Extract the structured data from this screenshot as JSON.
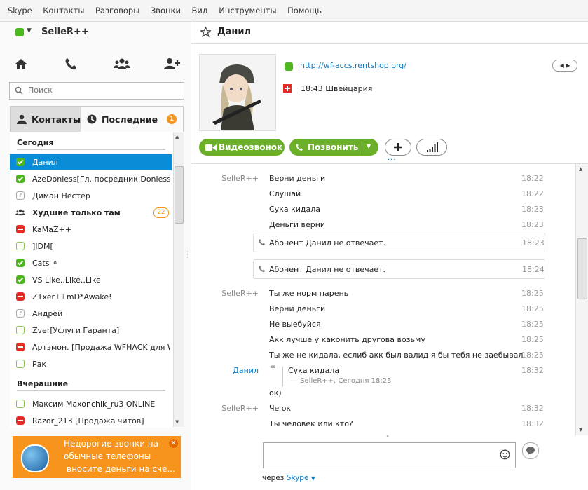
{
  "menu": [
    "Skype",
    "Контакты",
    "Разговоры",
    "Звонки",
    "Вид",
    "Инструменты",
    "Помощь"
  ],
  "user": {
    "name": "SelleR++"
  },
  "search": {
    "placeholder": "Поиск"
  },
  "tabs": {
    "contacts": "Контакты",
    "recent": "Последние",
    "recent_badge": "1"
  },
  "sections": {
    "today": "Сегодня",
    "yesterday": "Вчерашние"
  },
  "contacts_today": [
    {
      "name": "Данил",
      "status": "online",
      "selected": true
    },
    {
      "name": "AzeDonless[Гл. посредник DonlessHa...",
      "status": "online"
    },
    {
      "name": "Диман Нестер",
      "status": "unknown"
    },
    {
      "name": "Худшие только там",
      "status": "group",
      "badge": "22",
      "bold": true
    },
    {
      "name": "KaMaZ++",
      "status": "busy"
    },
    {
      "name": "]JDM[",
      "status": "offline"
    },
    {
      "name": "Cats ⚬",
      "status": "online"
    },
    {
      "name": "VS Like..Like..Like",
      "status": "online"
    },
    {
      "name": "Z1xer ☐ mD*Awake!",
      "status": "busy"
    },
    {
      "name": "Андрей",
      "status": "unknown"
    },
    {
      "name": "Zver[Услуги Гаранта]",
      "status": "offline"
    },
    {
      "name": "Артэмон. [Продажа WFHACK для WF]",
      "status": "busy"
    },
    {
      "name": "Рак",
      "status": "offline"
    }
  ],
  "contacts_yesterday": [
    {
      "name": "Максим Maxonchik_ru3 ONLINE",
      "status": "offline"
    },
    {
      "name": "Razor_213 [Продажа читов]",
      "status": "busy"
    }
  ],
  "ad": {
    "line1": "Недорогие звонки на",
    "line2": "обычные телефоны",
    "line3": "вносите деньги на сче..."
  },
  "chat": {
    "title": "Данил",
    "website": "http://wf-accs.rentshop.org/",
    "local_time": "18:43 Швейцария",
    "video_btn": "Видеозвонок",
    "call_btn": "Позвонить"
  },
  "messages": [
    {
      "sender": "SelleR++",
      "text": "Верни деньги",
      "time": "18:22"
    },
    {
      "sender": "",
      "text": "Слушай",
      "time": "18:22"
    },
    {
      "sender": "",
      "text": "Сука кидала",
      "time": "18:23"
    },
    {
      "sender": "",
      "text": "Деньги верни",
      "time": "18:23"
    },
    {
      "call": true,
      "text": "Абонент Данил не отвечает.",
      "time": "18:23"
    },
    {
      "call": true,
      "text": "Абонент Данил не отвечает.",
      "time": "18:24"
    },
    {
      "sender": "SelleR++",
      "text": "Ты же норм парень",
      "time": "18:25"
    },
    {
      "sender": "",
      "text": "Верни деньги",
      "time": "18:25"
    },
    {
      "sender": "",
      "text": "Не выебуйся",
      "time": "18:25"
    },
    {
      "sender": "",
      "text": "Акк лучше у каконить другова возьму",
      "time": "18:25"
    },
    {
      "sender": "",
      "text": "Ты же не кидала, еслиб акк был валид я бы тебя не заебывал",
      "time": "18:25"
    },
    {
      "sender": "Данил",
      "quote": "Сука кидала",
      "quote_src": "— SelleR++, Сегодня 18:23",
      "text": "ок)",
      "time": "18:32"
    },
    {
      "sender": "SelleR++",
      "text": "Че ок",
      "time": "18:32"
    },
    {
      "sender": "",
      "text": "Ты человек или кто?",
      "time": "18:32"
    }
  ],
  "compose": {
    "via": "через",
    "via_link": "Skype"
  },
  "colors": {
    "accent": "#0a8cd6",
    "green": "#6cb02a",
    "orange": "#f7941d"
  }
}
